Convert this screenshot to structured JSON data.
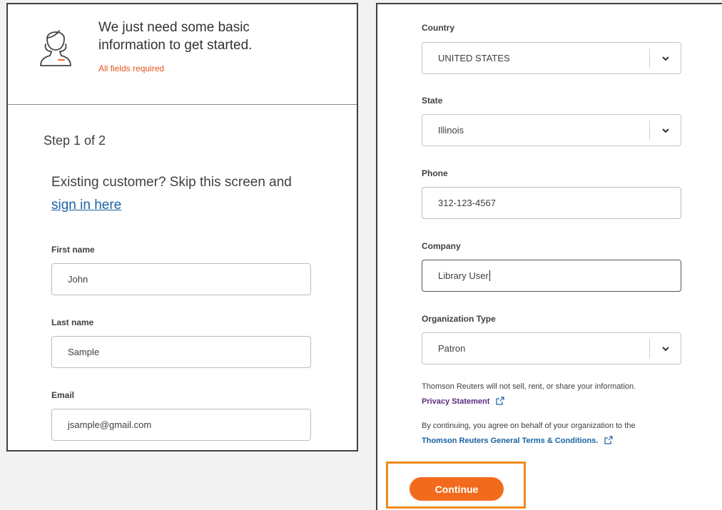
{
  "header": {
    "icon": "person-icon",
    "title": "We just need some basic information to get started.",
    "required_note": "All fields required"
  },
  "step": {
    "label": "Step 1 of 2",
    "existing_text": "Existing customer? Skip this screen and",
    "signin_link": "sign in here"
  },
  "left_form": {
    "first_name": {
      "label": "First name",
      "value": "John"
    },
    "last_name": {
      "label": "Last name",
      "value": "Sample"
    },
    "email": {
      "label": "Email",
      "value": "jsample@gmail.com"
    }
  },
  "right_form": {
    "country": {
      "label": "Country",
      "value": "UNITED STATES"
    },
    "state": {
      "label": "State",
      "value": "Illinois"
    },
    "phone": {
      "label": "Phone",
      "value": "312-123-4567"
    },
    "company": {
      "label": "Company",
      "value": "Library User"
    },
    "org_type": {
      "label": "Organization Type",
      "value": "Patron"
    }
  },
  "legal": {
    "privacy_note": "Thomson Reuters will not sell, rent, or share your information.",
    "privacy_link": "Privacy Statement",
    "terms_note": "By continuing, you agree on behalf of your organization to the",
    "terms_link": "Thomson Reuters General Terms & Conditions."
  },
  "actions": {
    "continue_label": "Continue"
  },
  "colors": {
    "accent": "#f26b1d",
    "highlight": "#f08a1d",
    "link": "#1a62a0",
    "required": "#e2561b"
  }
}
